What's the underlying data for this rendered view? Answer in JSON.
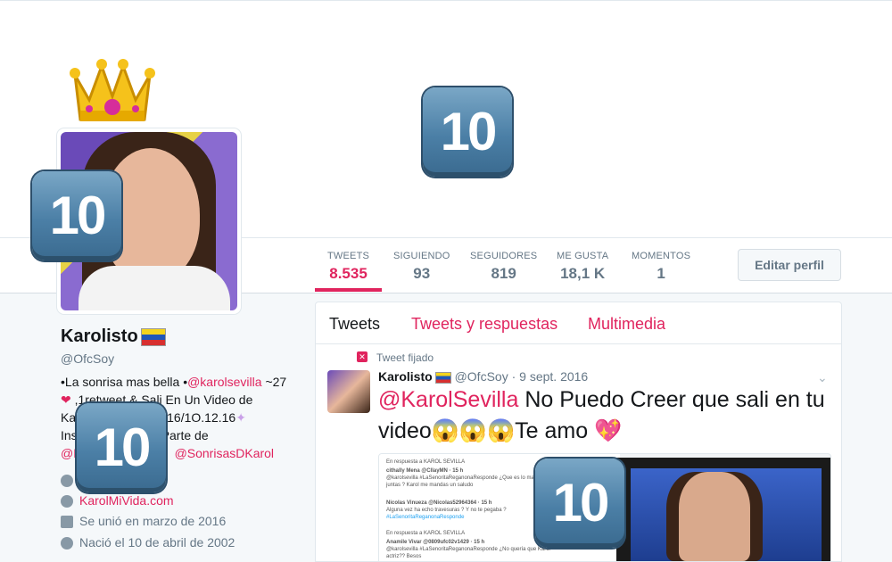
{
  "profile": {
    "name": "Karolisto",
    "handle": "@OfcSoy",
    "bio_lines": [
      "•La sonrisa mas bella •",
      "@karolsevilla",
      " ~27",
      " ,1retweet & Sali En Un Video de",
      "Ka",
      "16/1O.12.16",
      "Ins",
      "Parte de",
      "@K",
      "@SonrisasDKarol"
    ],
    "website": "KarolMiVida.com",
    "joined": "Se unió en marzo de 2016",
    "born": "Nació el 10 de abril de 2002"
  },
  "stats": [
    {
      "label": "TWEETS",
      "value": "8.535",
      "active": true
    },
    {
      "label": "SIGUIENDO",
      "value": "93"
    },
    {
      "label": "SEGUIDORES",
      "value": "819"
    },
    {
      "label": "ME GUSTA",
      "value": "18,1 K"
    },
    {
      "label": "MOMENTOS",
      "value": "1"
    }
  ],
  "edit_button": "Editar perfil",
  "tabs": [
    "Tweets",
    "Tweets y respuestas",
    "Multimedia"
  ],
  "tweet": {
    "pinned_label": "Tweet fijado",
    "author": "Karolisto",
    "handle": "@OfcSoy",
    "date": "· 9 sept. 2016",
    "mention": "@KarolSevilla",
    "text": " No Puedo Creer que sali en tu video",
    "text_end": "Te amo",
    "emoji": "😱😱😱"
  },
  "media_snippets": [
    "En respuesta a KAROL SEVILLA",
    "cithally Mena @CllayMN · 15 h",
    "@karolsevilla #LaSenoritaReganonaResponde ¿Que es lo mas les",
    "juntas ? Karol me mandas un saludo",
    "Nicolas Vinueza @Nicolas52964364 · 15 h",
    "Alguna vez ha echo travesuras ? Y no te pegaba ?",
    "#LaSenoritaReganonaResponde",
    "En respuesta a KAROL SEVILLA",
    "Anamile Vivar @0809ufc02v1429 · 15 h",
    "@karolsevilla #LaSenoritaReganonaResponde ¿No quería que Karol",
    "actriz?? Besos"
  ],
  "stickers": {
    "keycap_label": "10"
  },
  "colors": {
    "accent": "#e0245e",
    "muted": "#657786",
    "bg": "#f5f8fa"
  }
}
